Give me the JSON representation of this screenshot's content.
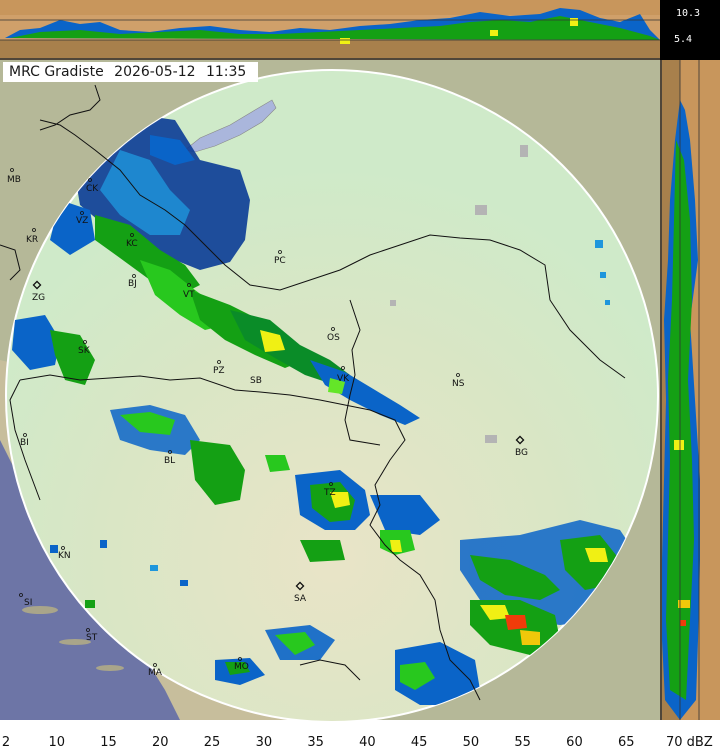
{
  "header": {
    "station": "MRC Gradiste",
    "date": "2026-05-12",
    "time": "11:35"
  },
  "height_scale": {
    "top": "10.3",
    "mid": "5.4"
  },
  "cities": [
    {
      "code": "MB"
    },
    {
      "code": "CK"
    },
    {
      "code": "VZ"
    },
    {
      "code": "KR"
    },
    {
      "code": "KC"
    },
    {
      "code": "PC"
    },
    {
      "code": "ZG"
    },
    {
      "code": "BJ"
    },
    {
      "code": "VT"
    },
    {
      "code": "OS"
    },
    {
      "code": "SK"
    },
    {
      "code": "PZ"
    },
    {
      "code": "SB"
    },
    {
      "code": "VK"
    },
    {
      "code": "NS"
    },
    {
      "code": "BI"
    },
    {
      "code": "BL"
    },
    {
      "code": "BG"
    },
    {
      "code": "TZ"
    },
    {
      "code": "KN"
    },
    {
      "code": "SI"
    },
    {
      "code": "SA"
    },
    {
      "code": "ST"
    },
    {
      "code": "MA"
    },
    {
      "code": "MO"
    }
  ],
  "legend": {
    "unit": "dBZ",
    "ticks": [
      "2",
      "10",
      "15",
      "20",
      "25",
      "30",
      "35",
      "40",
      "45",
      "50",
      "55",
      "60",
      "65",
      "70"
    ],
    "colors": [
      "#b4b4b4",
      "#1e96dc",
      "#0a64c8",
      "#0a3c96",
      "#0a8c28",
      "#14a014",
      "#28c81e",
      "#64e628",
      "#f0f014",
      "#f0c80a",
      "#f08c0a",
      "#f03c0a",
      "#c80a0a",
      "#8c0a8c"
    ]
  },
  "colors": {
    "land": "#b5b898",
    "sea": "#6d75a6",
    "radar_disc": "#cfeac9",
    "side_panel": "#c8965c"
  }
}
